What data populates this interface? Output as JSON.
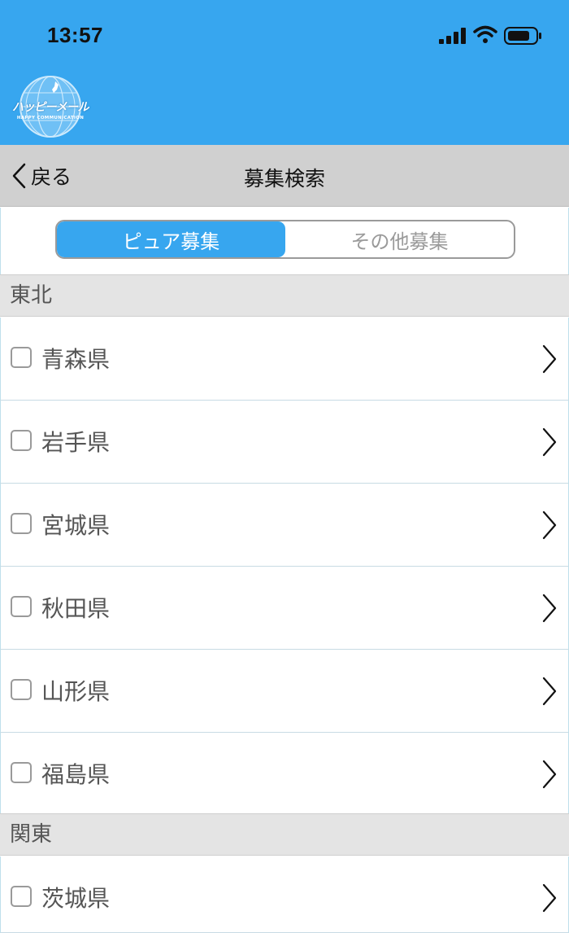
{
  "status_bar": {
    "time": "13:57"
  },
  "logo": {
    "text": "ハッピーメール",
    "subtext": "HAPPY COMMUNICATION"
  },
  "nav": {
    "back_label": "戻る",
    "title": "募集検索"
  },
  "tabs": [
    {
      "label": "ピュア募集",
      "active": true
    },
    {
      "label": "その他募集",
      "active": false
    }
  ],
  "sections": [
    {
      "region": "東北",
      "items": [
        "青森県",
        "岩手県",
        "宮城県",
        "秋田県",
        "山形県",
        "福島県"
      ]
    },
    {
      "region": "関東",
      "items": [
        "茨城県"
      ]
    }
  ],
  "colors": {
    "accent": "#37a6ef",
    "nav_bg": "#d0d0d0",
    "region_bg": "#e4e4e4"
  }
}
